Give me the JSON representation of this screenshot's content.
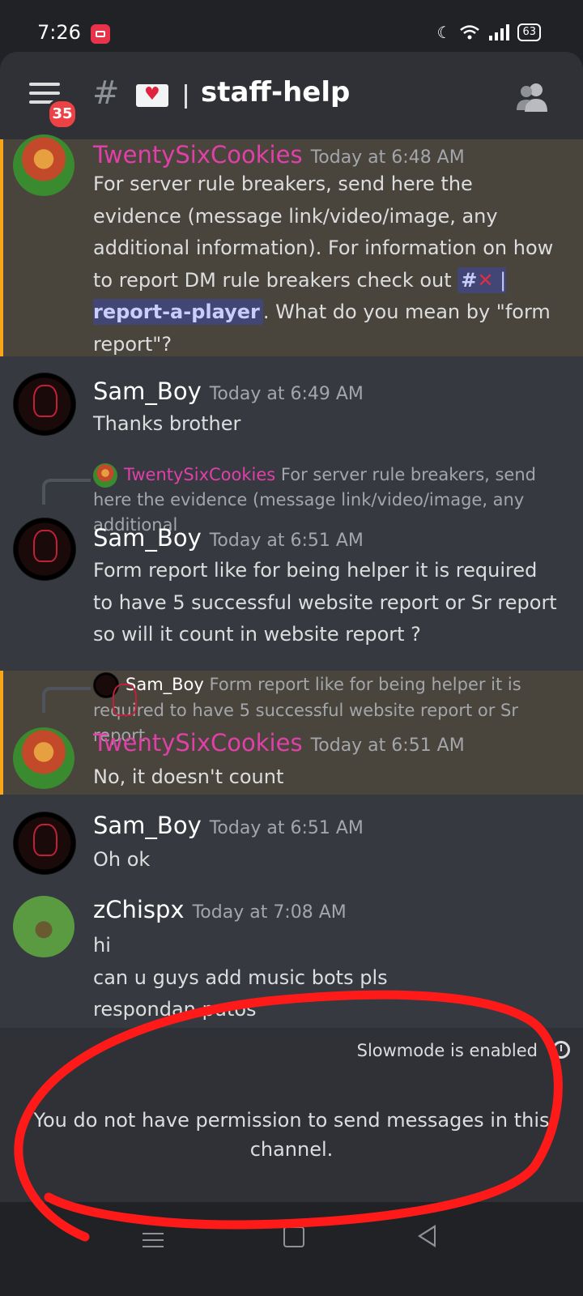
{
  "status_bar": {
    "time": "7:26",
    "battery": "63"
  },
  "header": {
    "badge_count": "35",
    "hash": "#",
    "channel_name": "staff-help",
    "channel_icon": "envelope-heart-icon"
  },
  "messages": [
    {
      "author": "TwentySixCookies",
      "timestamp": "Today at 6:48 AM",
      "text_before": "For server rule breakers, send here the evidence (message link/video/image, any additional information). For information on how to report DM rule breakers check out ",
      "channel_link_prefix": "#",
      "channel_link_sep": " | ",
      "channel_link_name": "report-a-player",
      "text_after": ". What do you mean by \"form report\"?"
    },
    {
      "author": "Sam_Boy",
      "timestamp": "Today at 6:49 AM",
      "text": "Thanks brother"
    },
    {
      "reply_author": "TwentySixCookies",
      "reply_text": "For server rule breakers, send here the evidence (message link/video/image, any additional",
      "author": "Sam_Boy",
      "timestamp": "Today at 6:51 AM",
      "text": "Form report like for being helper it is required to have 5 successful website report or Sr report so will it count in website report ?"
    },
    {
      "reply_author": "Sam_Boy",
      "reply_text": "Form report like for being helper it is required to have 5 successful website report or Sr report",
      "author": "TwentySixCookies",
      "timestamp": "Today at 6:51 AM",
      "text": "No, it doesn't count"
    },
    {
      "author": "Sam_Boy",
      "timestamp": "Today at 6:51 AM",
      "text": "Oh ok"
    },
    {
      "author": "zChispx",
      "timestamp": "Today at 7:08 AM",
      "line1": "hi",
      "line2": "can u guys add music bots pls",
      "line3": "respondan putos"
    }
  ],
  "footer": {
    "slowmode": "Slowmode is enabled",
    "no_permission": "You do not have permission to send messages in this channel."
  },
  "colors": {
    "mention_bar": "#faa61a",
    "mention_bg": "#49443c",
    "author_pink": "#e040a8",
    "annotation": "#ff1a1a"
  }
}
